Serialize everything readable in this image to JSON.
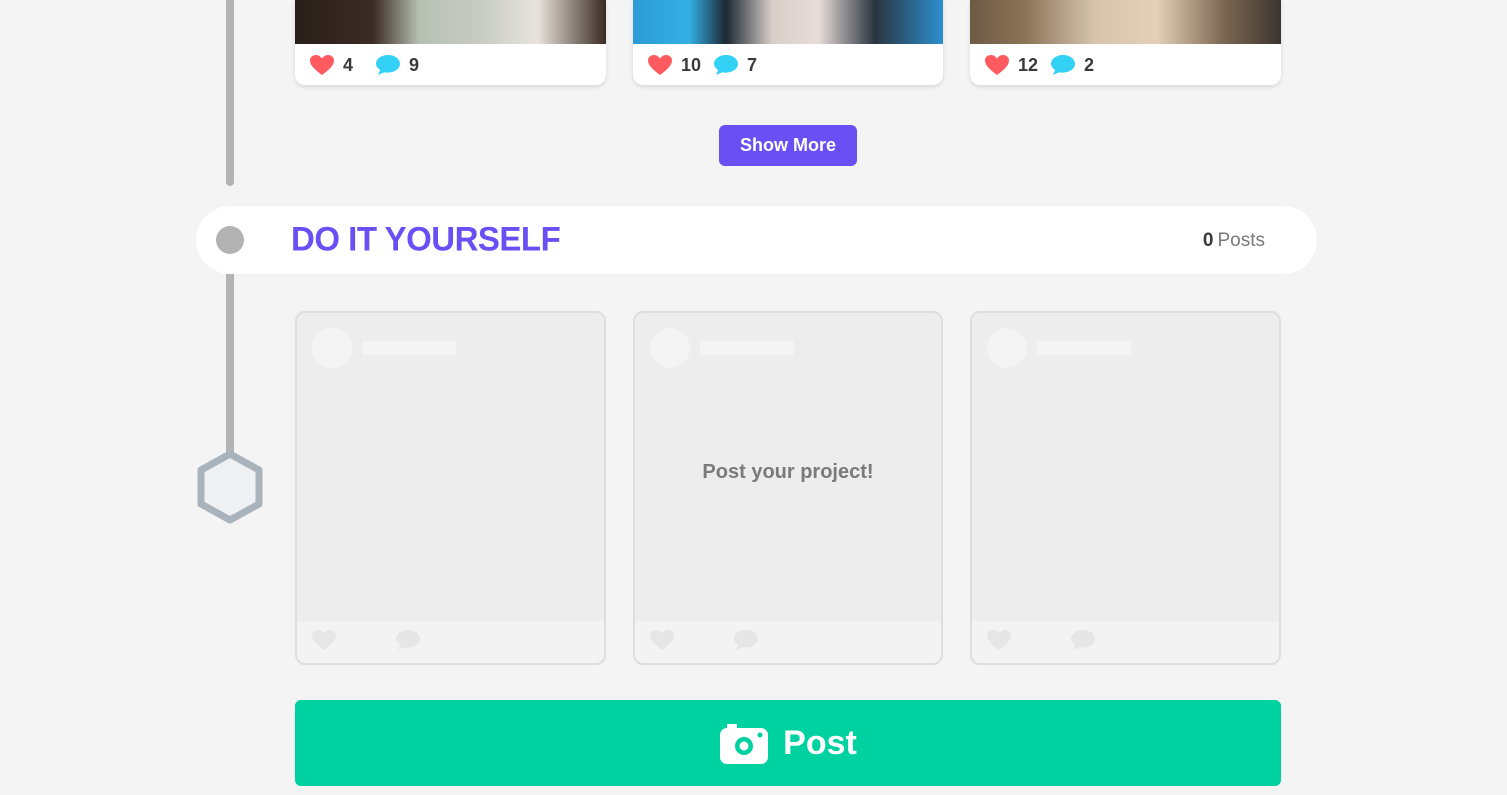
{
  "posts": [
    {
      "likes": "4",
      "comments": "9"
    },
    {
      "likes": "10",
      "comments": "7"
    },
    {
      "likes": "12",
      "comments": "2"
    }
  ],
  "show_more_label": "Show More",
  "section": {
    "title": "DO IT YOURSELF",
    "count": "0",
    "count_label": "Posts"
  },
  "placeholder": {
    "prompt": "Post your project!"
  },
  "post_button_label": "Post",
  "icons": {
    "like": "heart-icon",
    "comment": "speech-bubble-icon",
    "camera": "camera-icon",
    "timeline_marker": "hexagon-icon"
  },
  "colors": {
    "accent": "#6a4ff5",
    "post_button": "#00d1a1",
    "heart": "#ff5a5f",
    "comment": "#33d1f5"
  }
}
